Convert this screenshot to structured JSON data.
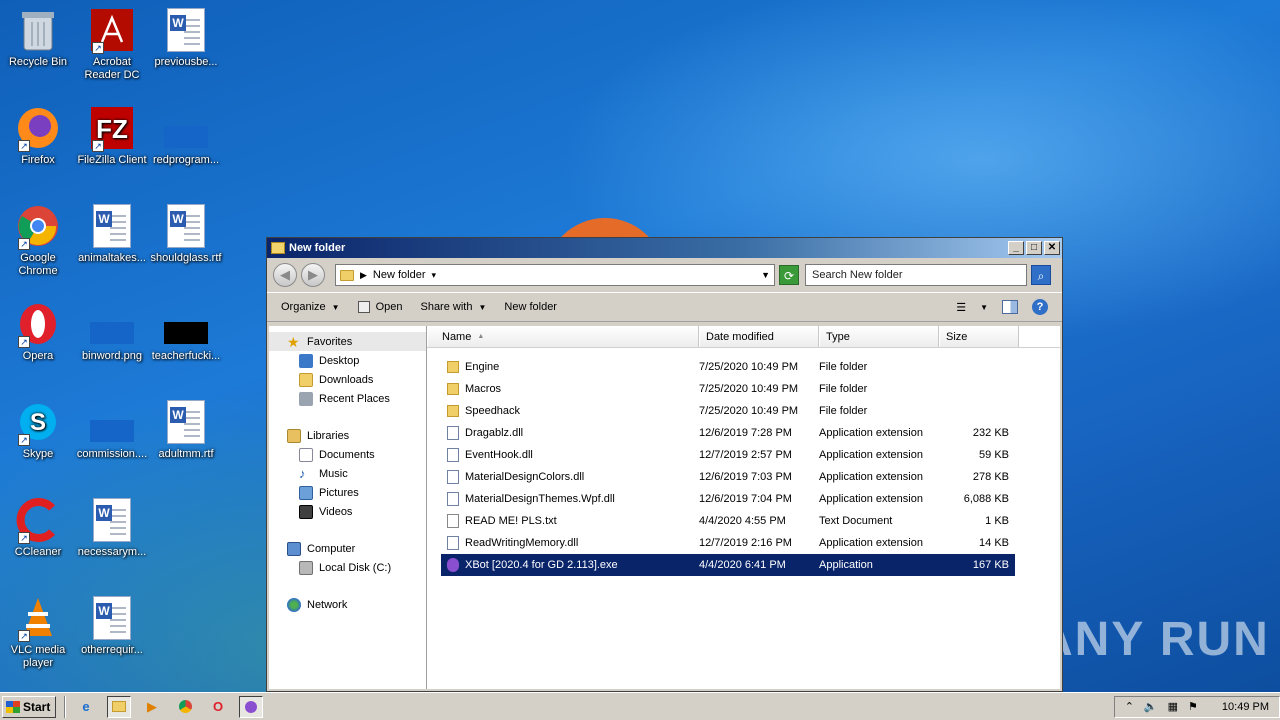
{
  "desktop": {
    "icons": [
      {
        "label": "Recycle Bin",
        "icon": "recycle-bin-icon"
      },
      {
        "label": "Acrobat Reader DC",
        "icon": "acrobat-icon"
      },
      {
        "label": "previousbe...",
        "icon": "word-document-icon"
      },
      {
        "label": "Firefox",
        "icon": "firefox-icon"
      },
      {
        "label": "FileZilla Client",
        "icon": "filezilla-icon"
      },
      {
        "label": "redprogram...",
        "icon": "image-thumbnail-icon"
      },
      {
        "label": "Google Chrome",
        "icon": "chrome-icon"
      },
      {
        "label": "animaltakes...",
        "icon": "word-document-icon"
      },
      {
        "label": "shouldglass.rtf",
        "icon": "word-document-icon"
      },
      {
        "label": "Opera",
        "icon": "opera-icon"
      },
      {
        "label": "binword.png",
        "icon": "image-thumbnail-icon"
      },
      {
        "label": "teacherfucki...",
        "icon": "image-thumbnail-icon"
      },
      {
        "label": "Skype",
        "icon": "skype-icon"
      },
      {
        "label": "commission....",
        "icon": "image-thumbnail-icon"
      },
      {
        "label": "adultmm.rtf",
        "icon": "word-document-icon"
      },
      {
        "label": "CCleaner",
        "icon": "ccleaner-icon"
      },
      {
        "label": "necessarym...",
        "icon": "word-document-icon"
      },
      {
        "label": "VLC media player",
        "icon": "vlc-icon"
      },
      {
        "label": "otherrequir...",
        "icon": "word-document-icon"
      }
    ]
  },
  "window": {
    "title": "New folder",
    "address": "New folder",
    "search_placeholder": "Search New folder",
    "toolbar": {
      "organize": "Organize",
      "open": "Open",
      "share_with": "Share with",
      "new_folder": "New folder"
    },
    "nav": {
      "favorites": "Favorites",
      "desktop": "Desktop",
      "downloads": "Downloads",
      "recent_places": "Recent Places",
      "libraries": "Libraries",
      "documents": "Documents",
      "music": "Music",
      "pictures": "Pictures",
      "videos": "Videos",
      "computer": "Computer",
      "local_disk": "Local Disk (C:)",
      "network": "Network"
    },
    "columns": {
      "name": "Name",
      "date": "Date modified",
      "type": "Type",
      "size": "Size"
    },
    "files": [
      {
        "name": "Engine",
        "date": "7/25/2020 10:49 PM",
        "type": "File folder",
        "size": "",
        "kind": "folder"
      },
      {
        "name": "Macros",
        "date": "7/25/2020 10:49 PM",
        "type": "File folder",
        "size": "",
        "kind": "folder"
      },
      {
        "name": "Speedhack",
        "date": "7/25/2020 10:49 PM",
        "type": "File folder",
        "size": "",
        "kind": "folder"
      },
      {
        "name": "Dragablz.dll",
        "date": "12/6/2019 7:28 PM",
        "type": "Application extension",
        "size": "232 KB",
        "kind": "dll"
      },
      {
        "name": "EventHook.dll",
        "date": "12/7/2019 2:57 PM",
        "type": "Application extension",
        "size": "59 KB",
        "kind": "dll"
      },
      {
        "name": "MaterialDesignColors.dll",
        "date": "12/6/2019 7:03 PM",
        "type": "Application extension",
        "size": "278 KB",
        "kind": "dll"
      },
      {
        "name": "MaterialDesignThemes.Wpf.dll",
        "date": "12/6/2019 7:04 PM",
        "type": "Application extension",
        "size": "6,088 KB",
        "kind": "dll"
      },
      {
        "name": "READ ME! PLS.txt",
        "date": "4/4/2020 4:55 PM",
        "type": "Text Document",
        "size": "1 KB",
        "kind": "txt"
      },
      {
        "name": "ReadWritingMemory.dll",
        "date": "12/7/2019 2:16 PM",
        "type": "Application extension",
        "size": "14 KB",
        "kind": "dll"
      },
      {
        "name": "XBot [2020.4 for GD 2.113].exe",
        "date": "4/4/2020 6:41 PM",
        "type": "Application",
        "size": "167 KB",
        "kind": "exe",
        "selected": true
      }
    ]
  },
  "watermark": "ANY RUN",
  "taskbar": {
    "start": "Start",
    "clock": "10:49 PM"
  }
}
